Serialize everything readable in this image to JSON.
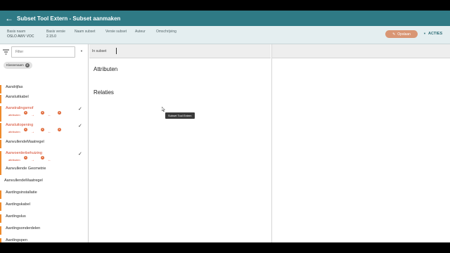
{
  "header": {
    "title": "Subset Tool Extern - Subset aanmaken",
    "back_icon": "arrow-left-icon"
  },
  "info": {
    "fields": [
      {
        "label": "Basis naam",
        "value": "OSLO AWV VOC"
      },
      {
        "label": "Basis versie",
        "value": "2.15.0"
      },
      {
        "label": "Naam subset",
        "value": ""
      },
      {
        "label": "Versie subset",
        "value": ""
      },
      {
        "label": "Auteur",
        "value": ""
      },
      {
        "label": "Omschrijving",
        "value": ""
      }
    ],
    "save_label": "Opslaan",
    "acties_label": "ACTIES"
  },
  "filter": {
    "placeholder": "Filter",
    "chip_label": "Klassenaam"
  },
  "classes": [
    {
      "name": "Aandrijfas",
      "marked": true,
      "active": false,
      "checked": false
    },
    {
      "name": "Aansluitkabel",
      "marked": true,
      "active": false,
      "checked": false
    },
    {
      "name": "Aanstralingsmof",
      "marked": true,
      "active": true,
      "checked": true,
      "sub": "attributen"
    },
    {
      "name": "Aansluitopening",
      "marked": true,
      "active": true,
      "checked": true,
      "sub": "attributen"
    },
    {
      "name": "Aanvoerderbehuizing",
      "marked": true,
      "active": true,
      "checked": true,
      "sub": "attributen"
    },
    {
      "name": "Aanvullende Geometrie",
      "marked": true,
      "active": false,
      "checked": false
    },
    {
      "name": "AanvullendeMaatregel",
      "marked": false,
      "active": false,
      "checked": false
    },
    {
      "name": "Aardingsinstallatie",
      "marked": true,
      "active": false,
      "checked": false
    },
    {
      "name": "Aardingskabel",
      "marked": true,
      "active": false,
      "checked": false
    },
    {
      "name": "Aardingslus",
      "marked": true,
      "active": false,
      "checked": false
    },
    {
      "name": "Aardingsonderdelen",
      "marked": true,
      "active": false,
      "checked": false
    },
    {
      "name": "Aardingspen",
      "marked": true,
      "active": false,
      "checked": false
    }
  ],
  "middle": {
    "header_label": "In subset",
    "section_attributes": "Attributen",
    "section_relations": "Relaties",
    "tooltip": "Subset Tool Extern"
  },
  "colors": {
    "topbar": "#2f7a85",
    "accent_orange": "#ef8a2b",
    "active_red": "#d4462a",
    "save_button": "#d99674"
  }
}
